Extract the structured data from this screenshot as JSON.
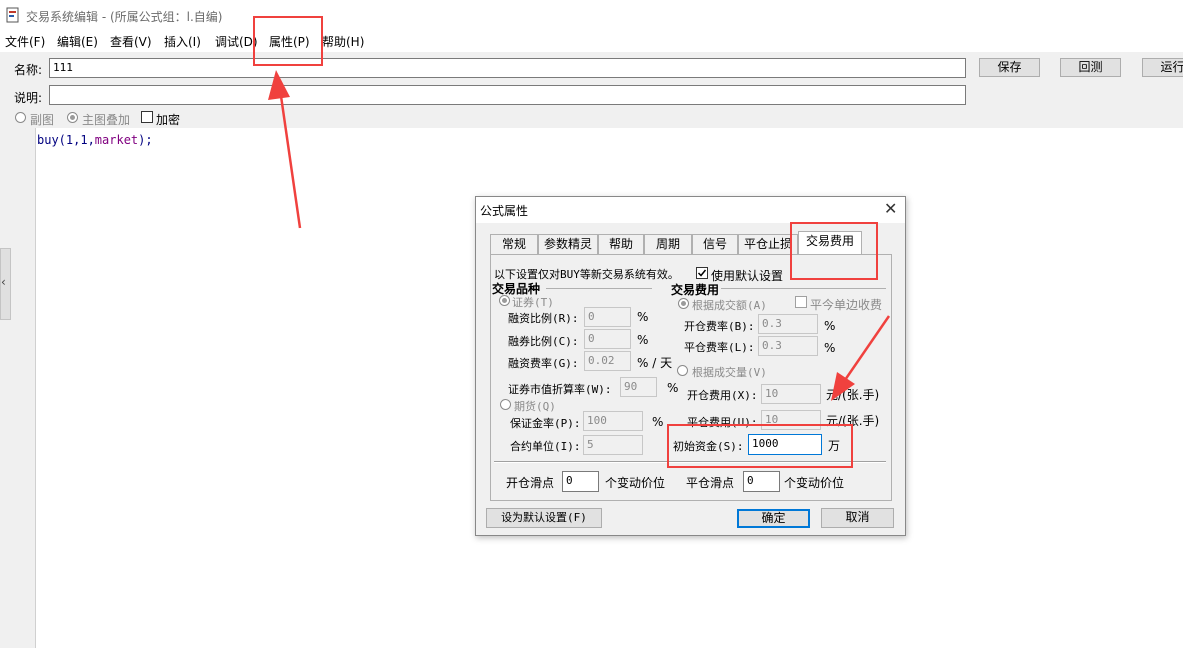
{
  "window": {
    "title": "交易系统编辑 - (所属公式组：l.自编)"
  },
  "menu": {
    "items": [
      "文件(F)",
      "编辑(E)",
      "查看(V)",
      "插入(I)",
      "调试(D)",
      "属性(P)",
      "帮助(H)"
    ]
  },
  "form": {
    "name_label": "名称:",
    "name_value": "111",
    "desc_label": "说明:",
    "desc_value": "",
    "save_btn": "保存",
    "backtest_btn": "回测",
    "run_btn": "运行",
    "sub_chart": "副图",
    "main_overlay": "主图叠加",
    "encrypt": "加密"
  },
  "editor": {
    "code_plain": "buy(1,1,",
    "code_kw": "market",
    "code_end": ");"
  },
  "dialog": {
    "title": "公式属性",
    "close": "✕",
    "tabs": [
      "常规",
      "参数精灵",
      "帮助",
      "周期",
      "信号",
      "平仓止损",
      "交易费用"
    ],
    "notice": "以下设置仅对BUY等新交易系统有效。",
    "use_default": "使用默认设置",
    "variety_group": "交易品种",
    "securities": "证券(T)",
    "margin_ratio_label": "融资比例(R):",
    "margin_ratio": "0",
    "short_ratio_label": "融券比例(C):",
    "short_ratio": "0",
    "fin_rate_label": "融资费率(G):",
    "fin_rate": "0.02",
    "fin_rate_unit": "% / 天",
    "discount_label": "证券市值折算率(W):",
    "discount": "90",
    "futures": "期货(Q)",
    "deposit_label": "保证金率(P):",
    "deposit": "100",
    "contract_label": "合约单位(I):",
    "contract": "5",
    "fee_group": "交易费用",
    "by_amount": "根据成交额(A)",
    "same_day": "平今单边收费",
    "open_rate_label": "开仓费率(B):",
    "open_rate": "0.3",
    "close_rate_label": "平仓费率(L):",
    "close_rate": "0.3",
    "by_volume": "根据成交量(V)",
    "open_fee_label": "开仓费用(X):",
    "open_fee": "10",
    "fee_unit": "元/(张.手)",
    "close_fee_label": "平仓费用(U):",
    "close_fee": "10",
    "init_capital_label": "初始资金(S):",
    "init_capital": "1000",
    "init_unit": "万",
    "open_slip_label": "开仓滑点",
    "open_slip": "0",
    "slip_unit": "个变动价位",
    "close_slip_label": "平仓滑点",
    "close_slip": "0",
    "set_default_btn": "设为默认设置(F)",
    "ok_btn": "确定",
    "cancel_btn": "取消",
    "percent": "%"
  },
  "colors": {
    "annotation": "#f0413e",
    "code": "#000080",
    "keyword": "#800080"
  }
}
